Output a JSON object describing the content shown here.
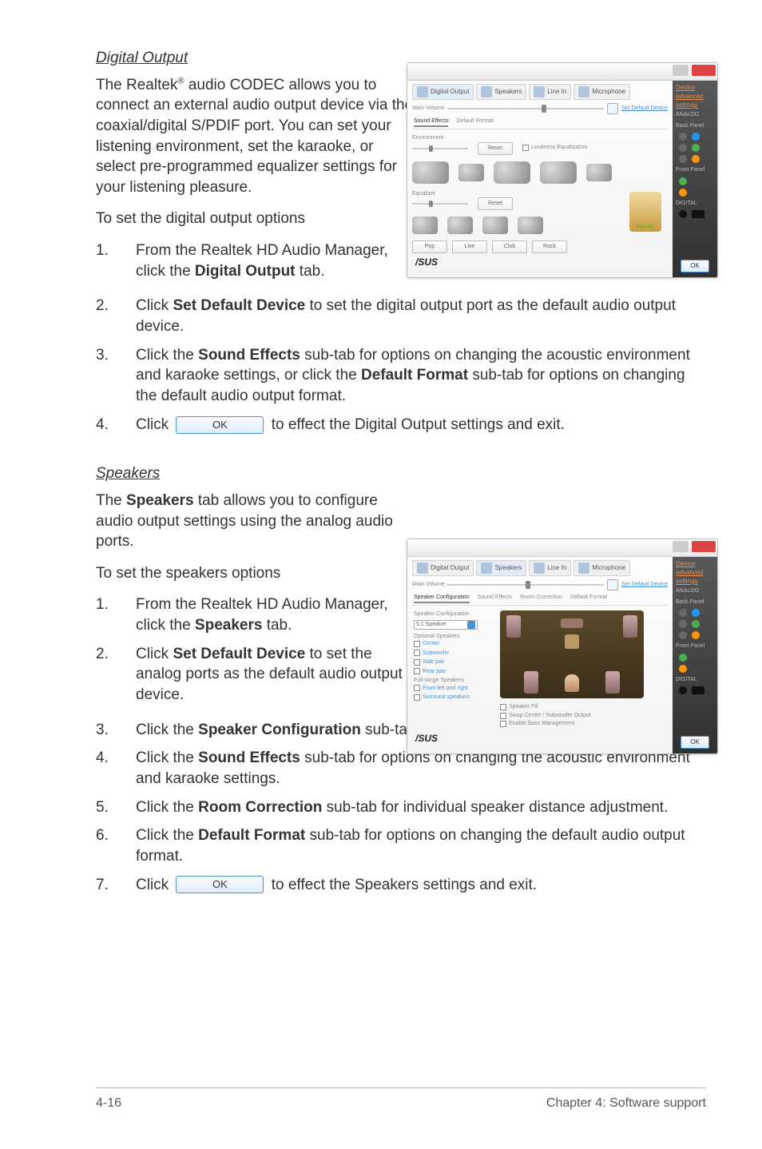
{
  "sections": {
    "digitalOutput": {
      "title": "Digital Output",
      "intro_pre": "The Realtek",
      "intro_sup": "®",
      "intro_post": " audio CODEC allows you to connect an external audio output device via the coaxial/digital S/PDIF port. You can set your listening environment, set the karaoke, or select pre-programmed equalizer settings for your listening pleasure.",
      "toSet": "To set the digital output options",
      "steps": {
        "s1_a": "From the Realtek HD Audio Manager, click the ",
        "s1_b": "Digital Output",
        "s1_c": " tab.",
        "s2_a": "Click ",
        "s2_b": "Set Default Device",
        "s2_c": " to set the digital output port as the default audio output device.",
        "s3_a": "Click the ",
        "s3_b": "Sound Effects",
        "s3_c": " sub-tab for options on changing the acoustic environment and karaoke settings, or click the ",
        "s3_d": "Default Format",
        "s3_e": " sub-tab for options on changing the default audio output format.",
        "s4_a": "Click ",
        "s4_b": " to effect the Digital Output settings and exit."
      }
    },
    "speakers": {
      "title": "Speakers",
      "intro_a": "The ",
      "intro_b": "Speakers",
      "intro_c": " tab allows you to configure audio output settings using the analog audio ports.",
      "toSet": "To set the speakers options",
      "steps": {
        "s1_a": "From the Realtek HD Audio Manager, click the ",
        "s1_b": "Speakers",
        "s1_c": " tab.",
        "s2_a": "Click ",
        "s2_b": "Set Default Device",
        "s2_c": " to set the analog ports as the default audio output device.",
        "s3_a": "Click the ",
        "s3_b": "Speaker Configuration",
        "s3_c": " sub-tab for audio channel options and test.",
        "s4_a": "Click the ",
        "s4_b": "Sound Effects",
        "s4_c": " sub-tab for options on changing the acoustic environment and karaoke settings.",
        "s5_a": "Click the ",
        "s5_b": "Room Correction",
        "s5_c": " sub-tab for individual speaker distance adjustment.",
        "s6_a": "Click the ",
        "s6_b": "Default Format",
        "s6_c": " sub-tab for options on changing the default audio output format.",
        "s7_a": "Click ",
        "s7_b": " to effect the Speakers settings and exit."
      }
    }
  },
  "nums": {
    "n1": "1.",
    "n2": "2.",
    "n3": "3.",
    "n4": "4.",
    "n5": "5.",
    "n6": "6.",
    "n7": "7."
  },
  "okLabel": "OK",
  "footer": {
    "left": "4-16",
    "right": "Chapter 4: Software support"
  },
  "shot": {
    "tabs": {
      "digital": "Digital Output",
      "speakers": "Speakers",
      "linein": "Line In",
      "mic": "Microphone"
    },
    "mainVolume": "Main Volume",
    "setDefault": "Set Default Device",
    "subtabs1": {
      "a": "Sound Effects",
      "b": "Default Format"
    },
    "subtabs2": {
      "a": "Speaker Configuration",
      "b": "Sound Effects",
      "c": "Room Correction",
      "d": "Default Format"
    },
    "env": "Environment",
    "equalizer": "Equalizer",
    "karaoke": "Karaoke",
    "btns": {
      "pop": "Pop",
      "live": "Live",
      "club": "Club",
      "rock": "Rock"
    },
    "sidebar": {
      "adv": "Device advanced settings",
      "analog": "ANALOG",
      "back": "Back Panel",
      "front": "Front Panel",
      "digital": "DIGITAL"
    },
    "asus": "/SUS",
    "spk": {
      "cfgLabel": "Speaker Configuration",
      "combo": "5.1 Speaker",
      "optHeader": "Optional Speakers",
      "center": "Center",
      "sub": "Subwoofer",
      "side": "Side pair",
      "rear": "Rear pair",
      "fullHeader": "Full-range Speakers",
      "frontLR": "Front left and right",
      "surround": "Surround speakers",
      "fill": "Speaker Fill",
      "swap": "Swap Center / Subwoofer Output",
      "bass": "Enable Bass Management"
    }
  }
}
